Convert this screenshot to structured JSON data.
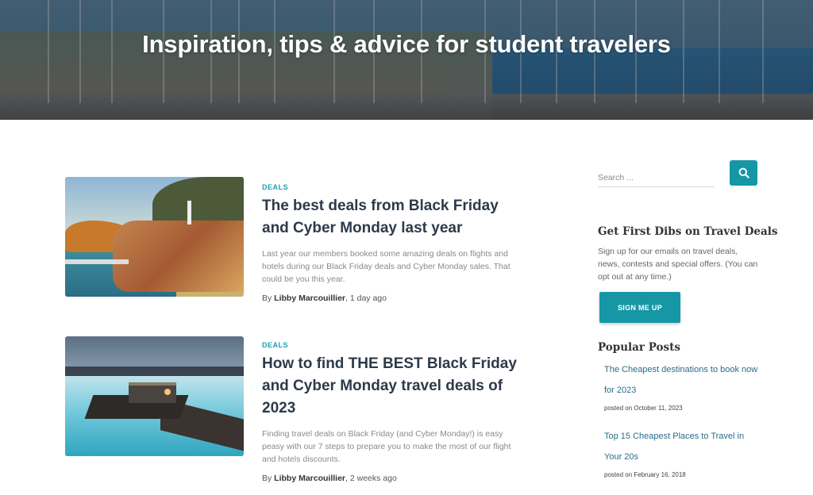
{
  "hero": {
    "title": "Inspiration, tips & advice for student travelers"
  },
  "posts": [
    {
      "category": "DEALS",
      "title": "The best deals from Black Friday and Cyber Monday last year",
      "excerpt": "Last year our members booked some amazing deals on flights and hotels during our Black Friday deals and Cyber Monday sales. That could be you this year.",
      "by": "By ",
      "author": "Libby Marcouillier",
      "time": ", 1 day ago"
    },
    {
      "category": "DEALS",
      "title": "How to find THE BEST Black Friday and Cyber Monday travel deals of 2023",
      "excerpt": "Finding travel deals on Black Friday (and Cyber Monday!) is easy peasy with our 7 steps to prepare you to make the most of our flight and hotels discounts.",
      "by": "By ",
      "author": "Libby Marcouillier",
      "time": ", 2 weeks ago"
    }
  ],
  "sidebar": {
    "search": {
      "placeholder": "Search ..."
    },
    "newsletter": {
      "title": "Get First Dibs on Travel Deals",
      "text": "Sign up for our emails on travel deals, news, contests and special offers. (You can opt out at any time.)",
      "button": "SIGN ME UP"
    },
    "popular": {
      "title": "Popular Posts",
      "items": [
        {
          "title": "The Cheapest destinations to book now for 2023",
          "date": "posted on October 11, 2023"
        },
        {
          "title": "Top 15 Cheapest Places to Travel in Your 20s",
          "date": "posted on February 16, 2018"
        }
      ]
    }
  },
  "colors": {
    "accent": "#1697a6",
    "category": "#1aa0b3",
    "link": "#2a6d8a",
    "title": "#2d3a4a"
  },
  "icons": {
    "search_button": "search-icon"
  }
}
